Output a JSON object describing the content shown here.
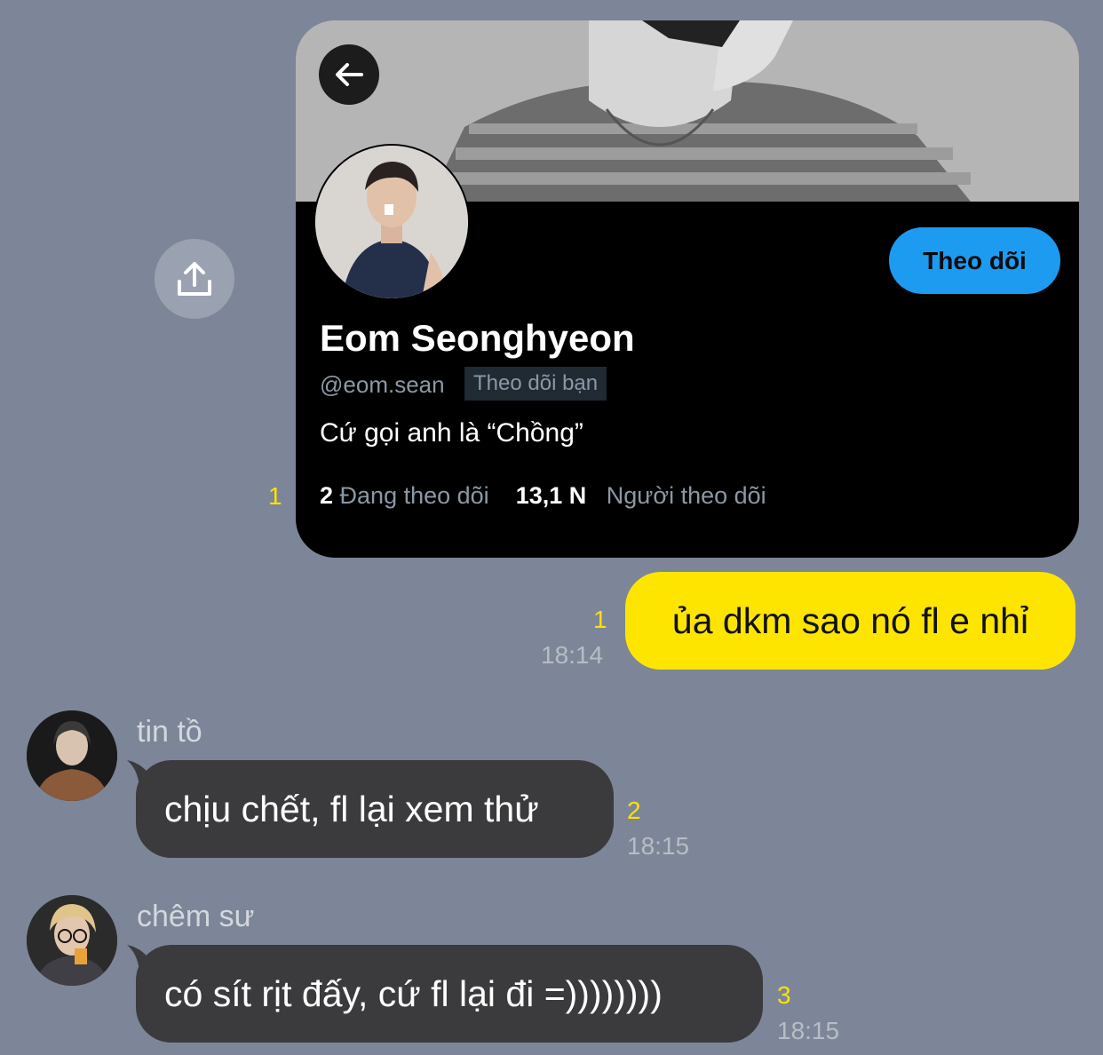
{
  "profile_card": {
    "display_name": "Eom Seonghyeon",
    "handle": "@eom.sean",
    "follows_you_badge": "Theo dõi bạn",
    "bio": "Cứ gọi anh là “Chồng”",
    "follow_button": "Theo dõi",
    "following_count": "2",
    "following_label": "Đang theo dõi",
    "followers_count": "13,1 N",
    "followers_label": "Người theo dõi",
    "read_count": "1"
  },
  "messages": [
    {
      "sender": "",
      "text": "ủa dkm sao nó fl e nhỉ",
      "read_count": "1",
      "time": "18:14"
    },
    {
      "sender": "tin tồ",
      "text": "chịu chết, fl lại xem thử",
      "read_count": "2",
      "time": "18:15"
    },
    {
      "sender": "chêm sư",
      "text": "có sít rịt đấy, cứ fl lại đi =))))))))",
      "read_count": "3",
      "time": "18:15"
    }
  ],
  "icons": {
    "share": "share-icon",
    "back": "back-arrow-icon"
  },
  "colors": {
    "background": "#7c8698",
    "outgoing_bubble": "#fee500",
    "incoming_bubble": "#3b3b3d",
    "follow_button": "#1d9bf0",
    "read_count": "#ffe100"
  }
}
